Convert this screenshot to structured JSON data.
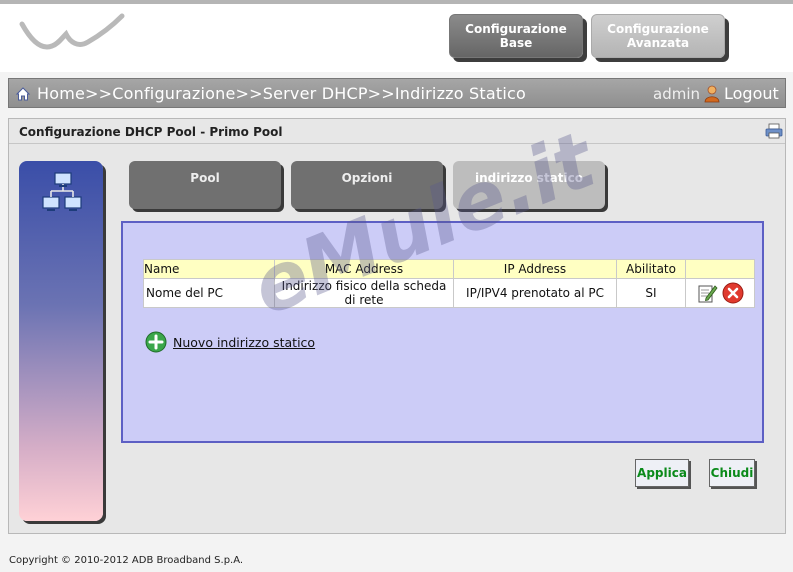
{
  "header": {
    "top_buttons": {
      "base": "Configurazione\nBase",
      "advanced": "Configurazione\nAvanzata"
    }
  },
  "breadcrumb": {
    "path": "Home>>Configurazione>>Server DHCP>>Indirizzo Statico",
    "user": "admin",
    "logout": "Logout"
  },
  "panel": {
    "title": "Configurazione DHCP Pool - Primo Pool"
  },
  "tabs": [
    {
      "label": "Pool"
    },
    {
      "label": "Opzioni"
    },
    {
      "label": "indirizzo statico"
    }
  ],
  "table": {
    "headers": [
      "Name",
      "MAC Address",
      "IP Address",
      "Abilitato",
      ""
    ],
    "rows": [
      {
        "name": "Nome del PC",
        "mac": "Indirizzo fisico della scheda di rete",
        "ip": "IP/IPV4 prenotato al PC",
        "enabled": "SI"
      }
    ]
  },
  "new_static": "Nuovo indirizzo statico",
  "buttons": {
    "apply": "Applica",
    "close": "Chiudi"
  },
  "watermark": "eMule.it",
  "footer": "Copyright © 2010-2012 ADB Broadband S.p.A.",
  "icons": {
    "logo": "logo-swoosh",
    "home": "home-icon",
    "user": "user-icon",
    "print": "print-icon",
    "network": "network-icon",
    "edit": "edit-icon",
    "delete": "delete-icon",
    "add": "plus-icon"
  },
  "colors": {
    "content_bg": "#ccccf7",
    "content_border": "#5d5fc4",
    "table_header_bg": "#ffffc2",
    "button_text": "#0a8a1a"
  }
}
